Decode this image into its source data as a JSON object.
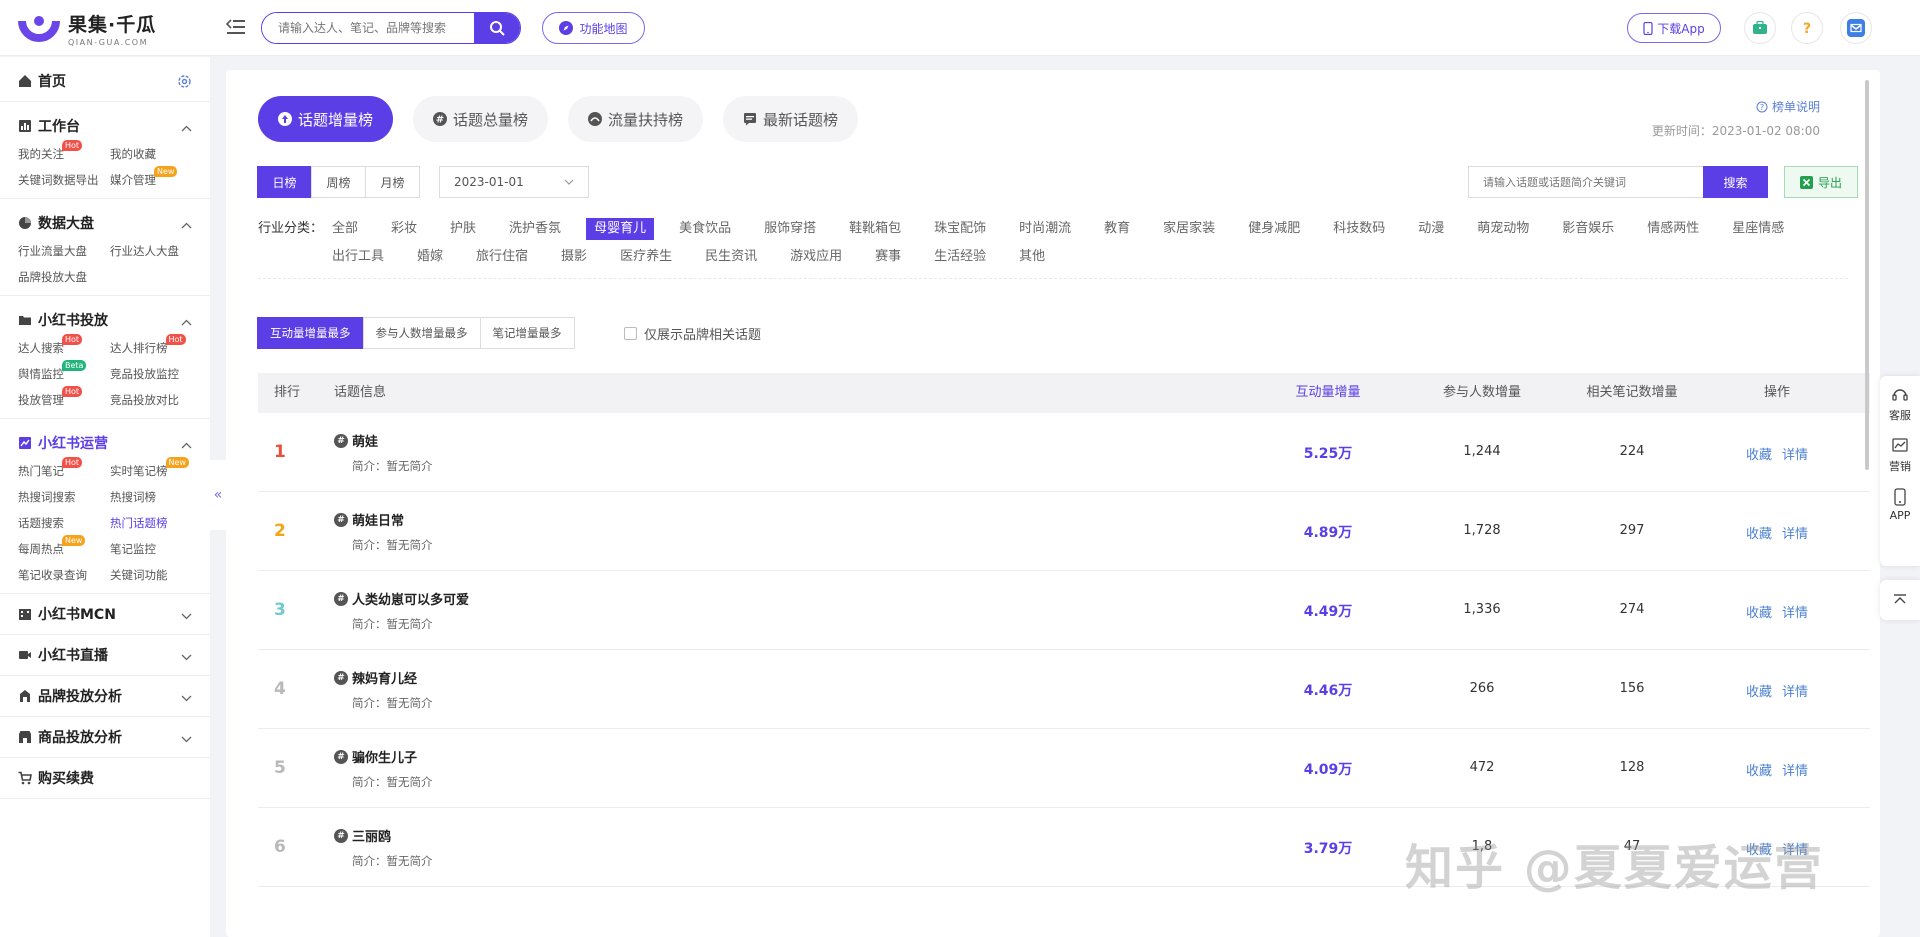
{
  "header": {
    "logo_title": "果集·千瓜",
    "logo_sub": "QIAN-GUA.COM",
    "search_placeholder": "请输入达人、笔记、品牌等搜索",
    "func_map_label": "功能地图",
    "download_app_label": "下载App"
  },
  "sidebar": {
    "home_label": "首页",
    "sections": [
      {
        "title": "工作台",
        "icon": "workbench-icon",
        "expanded": true,
        "items": [
          {
            "label": "我的关注",
            "badge": "Hot"
          },
          {
            "label": "我的收藏",
            "badge": ""
          },
          {
            "label": "关键词数据导出",
            "badge": ""
          },
          {
            "label": "媒介管理",
            "badge": "New"
          }
        ]
      },
      {
        "title": "数据大盘",
        "icon": "pie-chart-icon",
        "expanded": true,
        "items": [
          {
            "label": "行业流量大盘",
            "badge": ""
          },
          {
            "label": "行业达人大盘",
            "badge": ""
          },
          {
            "label": "品牌投放大盘",
            "badge": ""
          }
        ]
      },
      {
        "title": "小红书投放",
        "icon": "folder-icon",
        "expanded": true,
        "items": [
          {
            "label": "达人搜索",
            "badge": "Hot"
          },
          {
            "label": "达人排行榜",
            "badge": "Hot"
          },
          {
            "label": "舆情监控",
            "badge": "Beta"
          },
          {
            "label": "竞品投放监控",
            "badge": ""
          },
          {
            "label": "投放管理",
            "badge": "Hot"
          },
          {
            "label": "竞品投放对比",
            "badge": ""
          }
        ]
      },
      {
        "title": "小红书运营",
        "icon": "trend-icon",
        "expanded": true,
        "active": true,
        "items": [
          {
            "label": "热门笔记",
            "badge": "Hot"
          },
          {
            "label": "实时笔记榜",
            "badge": "New"
          },
          {
            "label": "热搜词搜索",
            "badge": ""
          },
          {
            "label": "热搜词榜",
            "badge": ""
          },
          {
            "label": "话题搜索",
            "badge": ""
          },
          {
            "label": "热门话题榜",
            "badge": "",
            "active": true
          },
          {
            "label": "每周热点",
            "badge": "New"
          },
          {
            "label": "笔记监控",
            "badge": ""
          },
          {
            "label": "笔记收录查询",
            "badge": ""
          },
          {
            "label": "关键词功能",
            "badge": ""
          }
        ]
      },
      {
        "title": "小红书MCN",
        "icon": "building-icon",
        "expanded": false,
        "items": []
      },
      {
        "title": "小红书直播",
        "icon": "video-icon",
        "expanded": false,
        "items": []
      },
      {
        "title": "品牌投放分析",
        "icon": "brand-icon",
        "expanded": false,
        "items": []
      },
      {
        "title": "商品投放分析",
        "icon": "shop-icon",
        "expanded": false,
        "items": []
      },
      {
        "title": "购买续费",
        "icon": "cart-icon",
        "expanded": false,
        "items": []
      }
    ]
  },
  "tabs": [
    {
      "label": "话题增量榜",
      "active": true
    },
    {
      "label": "话题总量榜",
      "active": false
    },
    {
      "label": "流量扶持榜",
      "active": false
    },
    {
      "label": "最新话题榜",
      "active": false
    }
  ],
  "legend_link": "榜单说明",
  "update_time": "更新时间：2023-01-02 08:00",
  "period_buttons": [
    {
      "label": "日榜",
      "active": true
    },
    {
      "label": "周榜",
      "active": false
    },
    {
      "label": "月榜",
      "active": false
    }
  ],
  "date_value": "2023-01-01",
  "kw_search": {
    "placeholder": "请输入话题或话题简介关键词",
    "button": "搜索"
  },
  "export_label": "导出",
  "industry_label": "行业分类：",
  "industries": [
    {
      "label": "全部"
    },
    {
      "label": "彩妆"
    },
    {
      "label": "护肤"
    },
    {
      "label": "洗护香氛"
    },
    {
      "label": "母婴育儿",
      "active": true
    },
    {
      "label": "美食饮品"
    },
    {
      "label": "服饰穿搭"
    },
    {
      "label": "鞋靴箱包"
    },
    {
      "label": "珠宝配饰"
    },
    {
      "label": "时尚潮流"
    },
    {
      "label": "教育"
    },
    {
      "label": "家居家装"
    },
    {
      "label": "健身减肥"
    },
    {
      "label": "科技数码"
    },
    {
      "label": "动漫"
    },
    {
      "label": "萌宠动物"
    },
    {
      "label": "影音娱乐"
    },
    {
      "label": "情感两性"
    },
    {
      "label": "星座情感"
    },
    {
      "label": "出行工具"
    },
    {
      "label": "婚嫁"
    },
    {
      "label": "旅行住宿"
    },
    {
      "label": "摄影"
    },
    {
      "label": "医疗养生"
    },
    {
      "label": "民生资讯"
    },
    {
      "label": "游戏应用"
    },
    {
      "label": "赛事"
    },
    {
      "label": "生活经验"
    },
    {
      "label": "其他"
    }
  ],
  "sort_buttons": [
    {
      "label": "互动量增量最多",
      "active": true
    },
    {
      "label": "参与人数增量最多",
      "active": false
    },
    {
      "label": "笔记增量最多",
      "active": false
    }
  ],
  "brand_only_label": "仅展示品牌相关话题",
  "table": {
    "headers": {
      "rank": "排行",
      "info": "话题信息",
      "interact": "互动量增量",
      "participants": "参与人数增量",
      "notes": "相关笔记数增量",
      "ops": "操作"
    },
    "rows": [
      {
        "rank": "1",
        "rank_color": "#e8503f",
        "name": "萌娃",
        "desc": "简介：暂无简介",
        "interact": "5.25万",
        "participants": "1,244",
        "notes": "224"
      },
      {
        "rank": "2",
        "rank_color": "#f2a516",
        "name": "萌娃日常",
        "desc": "简介：暂无简介",
        "interact": "4.89万",
        "participants": "1,728",
        "notes": "297"
      },
      {
        "rank": "3",
        "rank_color": "#6fcbd0",
        "name": "人类幼崽可以多可爱",
        "desc": "简介：暂无简介",
        "interact": "4.49万",
        "participants": "1,336",
        "notes": "274"
      },
      {
        "rank": "4",
        "rank_color": "#b9b9b9",
        "name": "辣妈育儿经",
        "desc": "简介：暂无简介",
        "interact": "4.46万",
        "participants": "266",
        "notes": "156"
      },
      {
        "rank": "5",
        "rank_color": "#b9b9b9",
        "name": "骗你生儿子",
        "desc": "简介：暂无简介",
        "interact": "4.09万",
        "participants": "472",
        "notes": "128"
      },
      {
        "rank": "6",
        "rank_color": "#b9b9b9",
        "name": "三丽鸥",
        "desc": "简介：暂无简介",
        "interact": "3.79万",
        "participants": "1,8",
        "notes": "47"
      }
    ],
    "op_collect": "收藏",
    "op_detail": "详情"
  },
  "float_bar": {
    "service": "客服",
    "marketing": "营销",
    "app": "APP"
  },
  "watermark": "知乎 @夏夏爱运营",
  "colors": {
    "accent": "#5b3ee6",
    "link": "#4e82d1",
    "export_green": "#22a04d"
  }
}
